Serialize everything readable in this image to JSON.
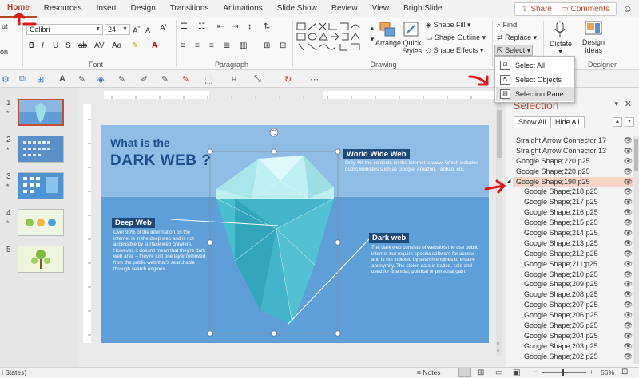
{
  "ribbon_tabs": [
    "Home",
    "Resources",
    "Insert",
    "Design",
    "Transitions",
    "Animations",
    "Slide Show",
    "Review",
    "View",
    "BrightSlide"
  ],
  "share_label": "Share",
  "comments_label": "Comments",
  "ribbon": {
    "clipboard_cut": "ut",
    "clipboard_other": "on",
    "font_name": "Calibri",
    "font_size": "24",
    "font_group": "Font",
    "paragraph_group": "Paragraph",
    "drawing_group": "Drawing",
    "designer_group": "Designer",
    "arrange_label": "Arrange",
    "quick_styles_label": "Quick Styles",
    "shape_fill": "Shape Fill",
    "shape_outline": "Shape Outline",
    "shape_effects": "Shape Effects",
    "find": "Find",
    "replace": "Replace",
    "select": "Select",
    "dictate": "Dictate",
    "design_ideas": "Design Ideas"
  },
  "select_menu": {
    "items": [
      "Select All",
      "Select Objects",
      "Selection Pane..."
    ]
  },
  "slides": [
    {
      "number": "1",
      "star": "*"
    },
    {
      "number": "2",
      "star": "*"
    },
    {
      "number": "3",
      "star": "*"
    },
    {
      "number": "4",
      "star": "*"
    },
    {
      "number": "5",
      "star": ""
    }
  ],
  "slide": {
    "title_line1": "What is the",
    "title_line2": "DARK WEB ?",
    "world_wide_web_heading": "World Wide Web",
    "world_wide_web_text": "Only 4% the contents on the Internet is www. Which includes public websites such as Google, Amazon, Taobao, etc.",
    "deep_web_heading": "Deep Web",
    "deep_web_text": "Over 90% of the information on the internet is in the deep web and is not accessible by surface web crawlers. However, it doesn't mean that they're dark web area – they're just one layer removed from the public web that's searchable through search engines.",
    "dark_web_heading": "Dark web",
    "dark_web_text": "The dark web consists of websites the use public internet but require specific software for access and is not indexed by search engines to ensure anonymity. The stolen data is traded, sold and used for financial, political or personal gain."
  },
  "selection_pane": {
    "title": "Selection",
    "show_all": "Show All",
    "hide_all": "Hide All",
    "items": [
      {
        "label": "Straight Arrow Connector 17",
        "indent": 0,
        "selected": false
      },
      {
        "label": "Straight Arrow Connector 13",
        "indent": 0,
        "selected": false
      },
      {
        "label": "Google Shape;220;p25",
        "indent": 0,
        "selected": false
      },
      {
        "label": "Google Shape;220;p25",
        "indent": 0,
        "selected": false
      },
      {
        "label": "Google Shape;190;p25",
        "indent": 0,
        "selected": true
      },
      {
        "label": "Google Shape;218;p25",
        "indent": 1,
        "selected": false
      },
      {
        "label": "Google Shape;217;p25",
        "indent": 1,
        "selected": false
      },
      {
        "label": "Google Shape;216;p25",
        "indent": 1,
        "selected": false
      },
      {
        "label": "Google Shape;215;p25",
        "indent": 1,
        "selected": false
      },
      {
        "label": "Google Shape;214;p25",
        "indent": 1,
        "selected": false
      },
      {
        "label": "Google Shape;213;p25",
        "indent": 1,
        "selected": false
      },
      {
        "label": "Google Shape;212;p25",
        "indent": 1,
        "selected": false
      },
      {
        "label": "Google Shape;211;p25",
        "indent": 1,
        "selected": false
      },
      {
        "label": "Google Shape;210;p25",
        "indent": 1,
        "selected": false
      },
      {
        "label": "Google Shape;209;p25",
        "indent": 1,
        "selected": false
      },
      {
        "label": "Google Shape;208;p25",
        "indent": 1,
        "selected": false
      },
      {
        "label": "Google Shape;207;p25",
        "indent": 1,
        "selected": false
      },
      {
        "label": "Google Shape;206;p25",
        "indent": 1,
        "selected": false
      },
      {
        "label": "Google Shape;205;p25",
        "indent": 1,
        "selected": false
      },
      {
        "label": "Google Shape;204;p25",
        "indent": 1,
        "selected": false
      },
      {
        "label": "Google Shape;203;p25",
        "indent": 1,
        "selected": false
      },
      {
        "label": "Google Shape;202;p25",
        "indent": 1,
        "selected": false
      }
    ]
  },
  "statusbar": {
    "left_text": "l States)",
    "notes": "Notes",
    "zoom": "56%"
  },
  "colors": {
    "accent": "#b7472a",
    "slide_sky": "#8fbde6",
    "slide_sea": "#5f9fd8",
    "heading_bar": "#1e4a7a",
    "annotation_red": "#e0161b"
  }
}
